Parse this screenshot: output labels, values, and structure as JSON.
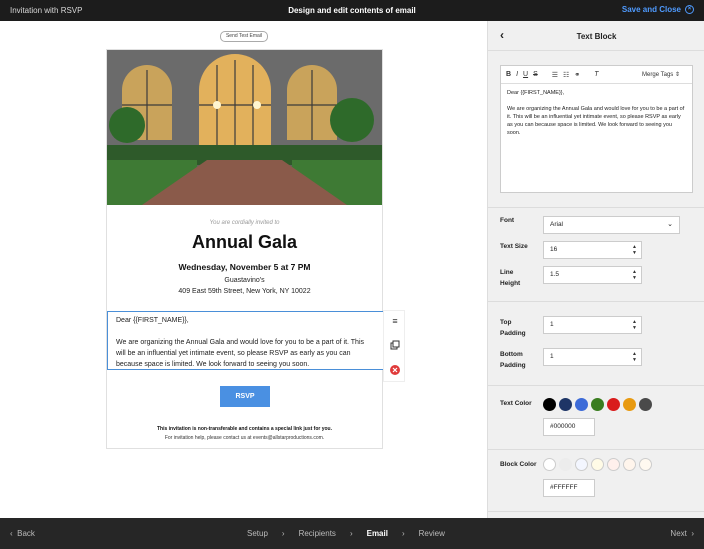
{
  "topbar": {
    "left": "Invitation with RSVP",
    "center": "Design and edit contents of email",
    "right": "Save and Close"
  },
  "canvas": {
    "send_test": "Send Test Email",
    "invite_line": "You are cordially invited to",
    "title": "Annual Gala",
    "date": "Wednesday, November 5 at 7 PM",
    "venue": "Guastavino's",
    "address": "409 East 59th Street, New York, NY 10022",
    "greeting": "Dear {{FIRST_NAME}},",
    "body": "We are organizing the Annual Gala and would love for you to be a part of it. This will be an influential yet intimate event, so please RSVP as early as you can because space is limited. We look forward to seeing you soon.",
    "rsvp": "RSVP",
    "footer1": "This invitation is non-transferable and contains a special link just for you.",
    "footer2": "For invitation help, please contact us at events@allstarproductions.com."
  },
  "panel": {
    "title": "Text Block",
    "merge_tags": "Merge Tags",
    "editor_greeting": "Dear {{FIRST_NAME}},",
    "editor_body": "We are organizing the Annual Gala and would love for you to be a part of it. This will be an influential yet intimate event, so please RSVP as early as you can because space is limited. We look forward to seeing you soon.",
    "font_label": "Font",
    "font_value": "Arial",
    "size_label": "Text Size",
    "size_value": "16",
    "line_label": "Line Height",
    "line_value": "1.5",
    "top_label": "Top Padding",
    "top_value": "1",
    "bottom_label": "Bottom Padding",
    "bottom_value": "1",
    "text_color_label": "Text Color",
    "text_color_value": "#000000",
    "text_swatches": [
      "#000000",
      "#1e3566",
      "#3d6bd8",
      "#3a7d1f",
      "#d91c1c",
      "#e89a10",
      "#4a4a4a"
    ],
    "block_color_label": "Block Color",
    "block_color_value": "#FFFFFF",
    "block_swatches": [
      "#ffffff",
      "#ececec",
      "#f3f6ff",
      "#fffbe6",
      "#fff0ec",
      "#fff5ec",
      "#fff9f0"
    ]
  },
  "bottombar": {
    "back": "Back",
    "steps": [
      "Setup",
      "Recipients",
      "Email",
      "Review"
    ],
    "next": "Next"
  }
}
